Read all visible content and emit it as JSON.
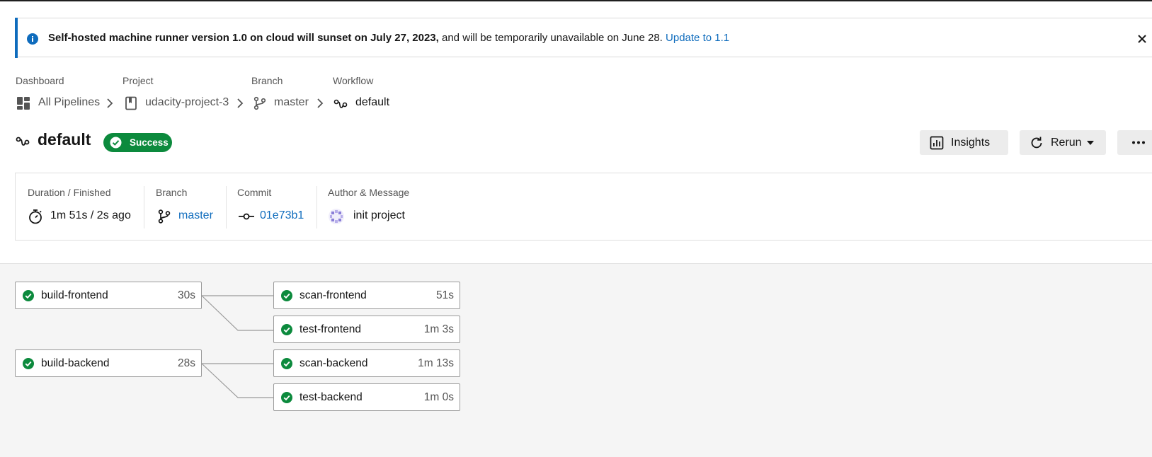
{
  "banner": {
    "bold_text": "Self-hosted machine runner version 1.0 on cloud will sunset on July 27, 2023,",
    "text": " and will be temporarily unavailable on June 28. ",
    "link": "Update to 1.1"
  },
  "breadcrumb": {
    "dashboard_label": "Dashboard",
    "dashboard_value": "All Pipelines",
    "project_label": "Project",
    "project_value": "udacity-project-3",
    "branch_label": "Branch",
    "branch_value": "master",
    "workflow_label": "Workflow",
    "workflow_value": "default"
  },
  "header": {
    "title": "default",
    "status": "Success",
    "insights_label": "Insights",
    "rerun_label": "Rerun"
  },
  "details": {
    "duration_label": "Duration / Finished",
    "duration_value": "1m 51s / 2s ago",
    "branch_label": "Branch",
    "branch_value": "master",
    "commit_label": "Commit",
    "commit_value": "01e73b1",
    "author_label": "Author & Message",
    "author_message": "init project"
  },
  "jobs": [
    {
      "name": "build-frontend",
      "duration": "30s"
    },
    {
      "name": "scan-frontend",
      "duration": "51s"
    },
    {
      "name": "test-frontend",
      "duration": "1m 3s"
    },
    {
      "name": "build-backend",
      "duration": "28s"
    },
    {
      "name": "scan-backend",
      "duration": "1m 13s"
    },
    {
      "name": "test-backend",
      "duration": "1m 0s"
    }
  ],
  "colors": {
    "accent": "#0f6cbd",
    "success": "#0c8a3d"
  },
  "icons": {
    "banner": "info-icon",
    "close": "close-icon",
    "dashboard": "dashboard-grid-icon",
    "project": "project-book-icon",
    "branch": "git-branch-icon",
    "workflow": "workflow-icon",
    "duration": "stopwatch-icon",
    "commit": "git-commit-icon",
    "author": "author-avatar",
    "job_status": "success-check-icon"
  }
}
